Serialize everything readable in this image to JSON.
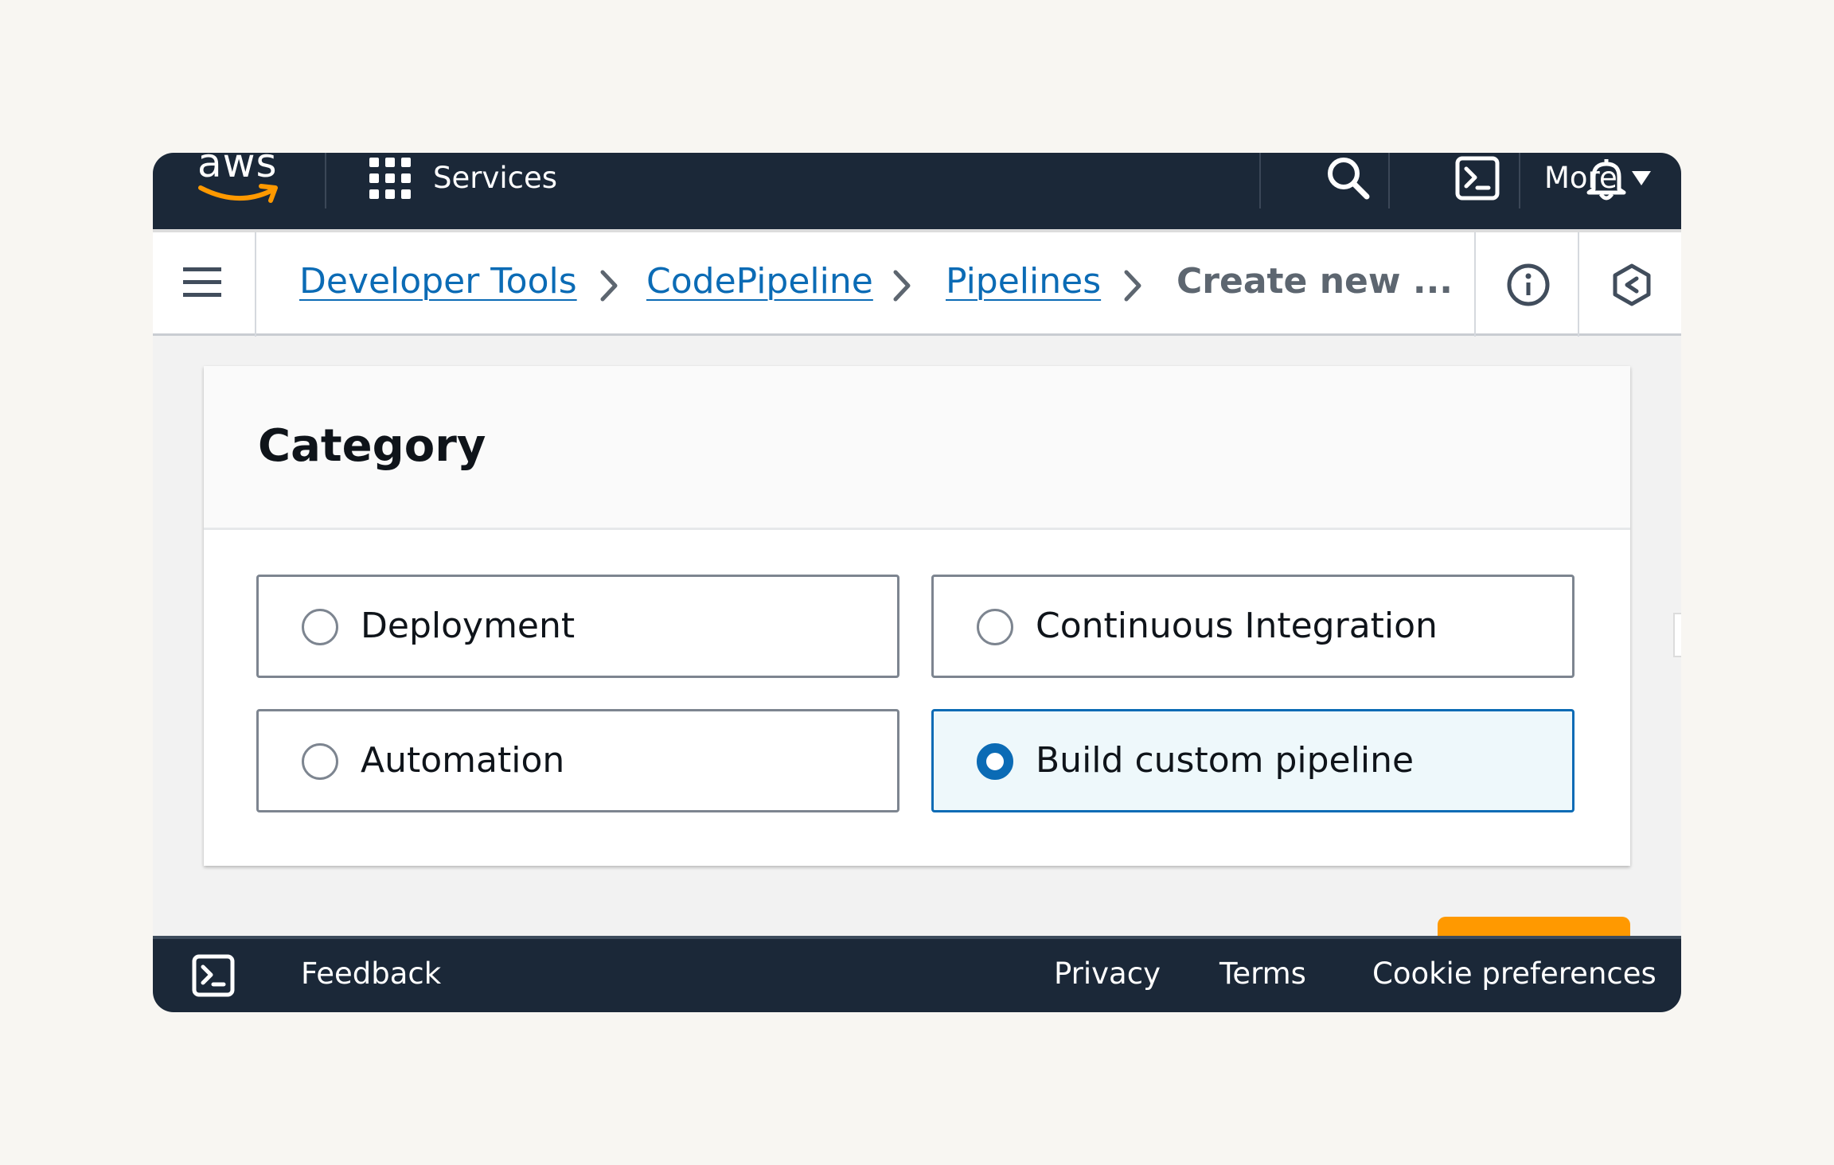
{
  "topnav": {
    "logo_text": "aws",
    "services_label": "Services",
    "more_label": "More",
    "icons": [
      "grid-icon",
      "search-icon",
      "cloudshell-icon",
      "bell-icon",
      "caret-down-icon"
    ]
  },
  "breadcrumb": {
    "items": [
      {
        "label": "Developer Tools"
      },
      {
        "label": "CodePipeline"
      },
      {
        "label": "Pipelines"
      }
    ],
    "current": "Create new ...",
    "icons": [
      "menu-icon",
      "info-icon",
      "settings-hex-icon"
    ]
  },
  "category": {
    "title": "Category",
    "options": [
      {
        "label": "Deployment",
        "selected": false
      },
      {
        "label": "Continuous Integration",
        "selected": false
      },
      {
        "label": "Automation",
        "selected": false
      },
      {
        "label": "Build custom pipeline",
        "selected": true
      }
    ]
  },
  "footer": {
    "feedback_label": "Feedback",
    "privacy_label": "Privacy",
    "terms_label": "Terms",
    "cookie_label": "Cookie preferences"
  },
  "colors": {
    "nav_bg": "#1b2838",
    "link": "#0b6bb5",
    "selected_bg": "#eef8fb",
    "accent_orange": "#ff9900",
    "aws_smile": "#ff9900"
  }
}
